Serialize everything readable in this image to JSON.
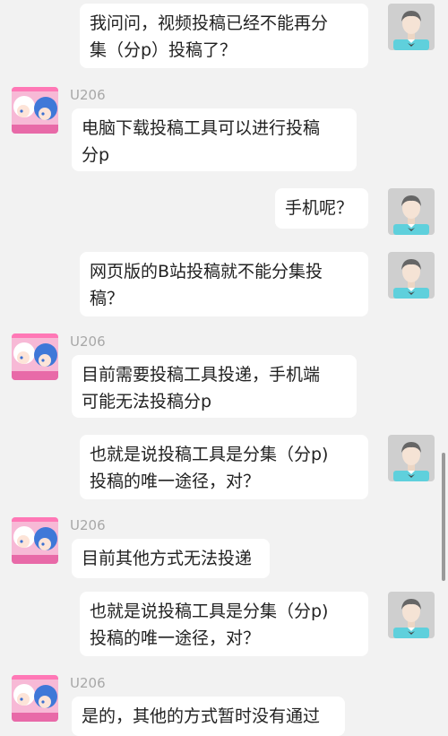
{
  "messages": [
    {
      "side": "right",
      "lines": [
        "我问问，视频投稿已经不能再分",
        "集（分p）投稿了？"
      ]
    },
    {
      "side": "left",
      "name": "U206",
      "lines": [
        "电脑下载投稿工具可以进行投稿",
        "分p"
      ]
    },
    {
      "side": "right",
      "lines": [
        "手机呢？"
      ]
    },
    {
      "side": "right",
      "lines": [
        "网页版的B站投稿就不能分集投",
        "稿？"
      ]
    },
    {
      "side": "left",
      "name": "U206",
      "lines": [
        "目前需要投稿工具投递，手机端",
        "可能无法投稿分p"
      ]
    },
    {
      "side": "right",
      "lines": [
        "也就是说投稿工具是分集（分p)",
        "投稿的唯一途径，对？"
      ]
    },
    {
      "side": "left",
      "name": "U206",
      "lines": [
        "目前其他方式无法投递"
      ]
    },
    {
      "side": "right",
      "lines": [
        "也就是说投稿工具是分集（分p)",
        "投稿的唯一途径，对？"
      ]
    },
    {
      "side": "left",
      "name": "U206",
      "lines": [
        "是的，其他的方式暂时没有通过"
      ]
    }
  ],
  "colors": {
    "background": "#f2f2f2",
    "bubble": "#ffffff",
    "user_avatar_bg": "#cfcfcf",
    "user_shirt": "#5fd0dc",
    "name_text": "#a8a8a8"
  },
  "icons": {
    "user_avatar": "default-user-avatar-icon",
    "other_avatar": "anime-avatar-icon"
  }
}
